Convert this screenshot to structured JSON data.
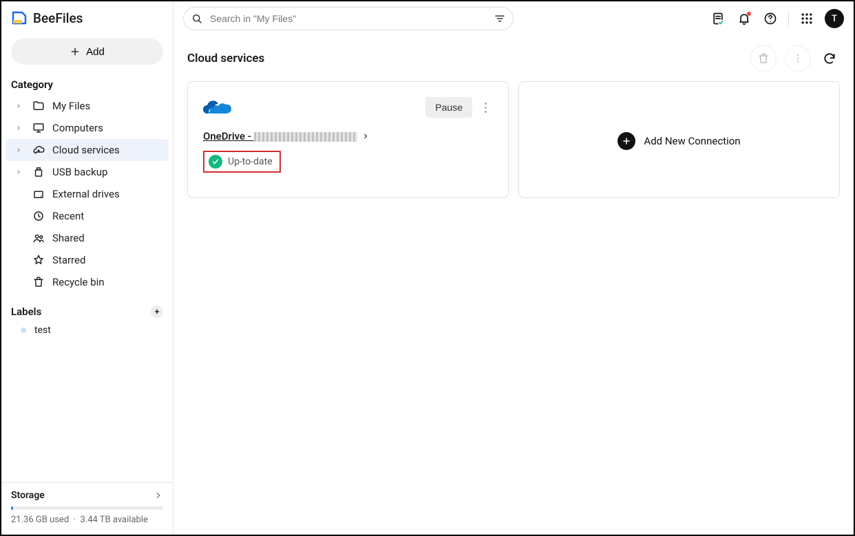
{
  "brand": {
    "name": "BeeFiles"
  },
  "add_label": "Add",
  "search": {
    "placeholder": "Search in \"My Files\""
  },
  "avatar_initial": "T",
  "sidebar": {
    "category_title": "Category",
    "items": [
      {
        "label": "My Files",
        "icon": "folder",
        "chev": true
      },
      {
        "label": "Computers",
        "icon": "monitor",
        "chev": true
      },
      {
        "label": "Cloud services",
        "icon": "cloud",
        "chev": true,
        "active": true
      },
      {
        "label": "USB backup",
        "icon": "usb",
        "chev": true
      },
      {
        "label": "External drives",
        "icon": "disk",
        "chev": false
      },
      {
        "label": "Recent",
        "icon": "clock",
        "chev": false
      },
      {
        "label": "Shared",
        "icon": "people",
        "chev": false
      },
      {
        "label": "Starred",
        "icon": "star",
        "chev": false
      },
      {
        "label": "Recycle bin",
        "icon": "trash",
        "chev": false
      }
    ],
    "labels_title": "Labels",
    "labels": [
      {
        "name": "test"
      }
    ]
  },
  "storage": {
    "title": "Storage",
    "used_text": "21.36 GB used",
    "total_text": "3.44 TB available"
  },
  "page": {
    "title": "Cloud services",
    "pause_label": "Pause",
    "svc_prefix": "OneDrive - ",
    "status_label": "Up-to-date",
    "add_connection_label": "Add New Connection"
  }
}
